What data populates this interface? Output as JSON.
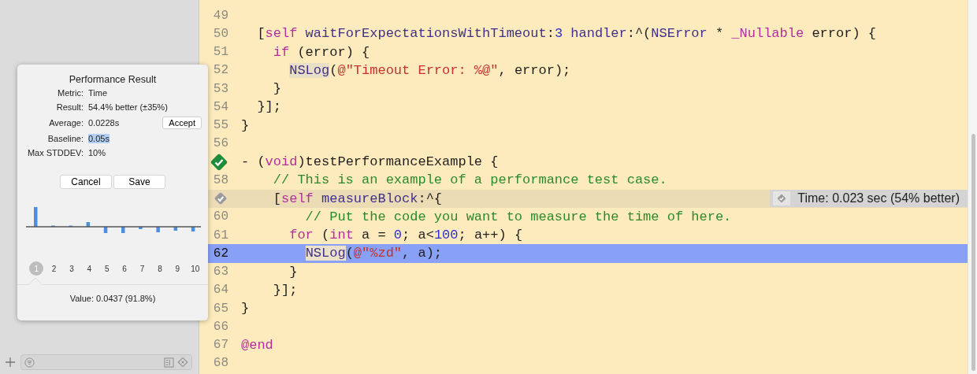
{
  "popover": {
    "title": "Performance Result",
    "fields": [
      {
        "label": "Metric:",
        "value": "Time",
        "selected": false
      },
      {
        "label": "Result:",
        "value": "54.4% better (±35%)",
        "selected": false
      },
      {
        "label": "Average:",
        "value": "0.0228s",
        "selected": false,
        "action": "Accept"
      },
      {
        "label": "Baseline:",
        "value": "0.05s",
        "selected": true
      },
      {
        "label": "Max STDDEV:",
        "value": "10%",
        "selected": false
      }
    ],
    "buttons": [
      "Cancel",
      "Save"
    ],
    "iterations": [
      {
        "label": "1",
        "selected": true
      },
      {
        "label": "2",
        "selected": false
      },
      {
        "label": "3",
        "selected": false
      },
      {
        "label": "4",
        "selected": false
      },
      {
        "label": "5",
        "selected": false
      },
      {
        "label": "6",
        "selected": false
      },
      {
        "label": "7",
        "selected": false
      },
      {
        "label": "8",
        "selected": false
      },
      {
        "label": "9",
        "selected": false
      },
      {
        "label": "10",
        "selected": false
      }
    ],
    "value_text": "Value:  0.0437 (91.8%)"
  },
  "editor": {
    "lines": [
      {
        "kind": "code",
        "number": "49",
        "selected": false,
        "highlighted": false
      },
      {
        "kind": "code",
        "number": "50",
        "selected": false,
        "highlighted": false,
        "tokens": [
          {
            "text": "  [",
            "kind": "plain"
          },
          {
            "text": "self",
            "kind": "keyword"
          },
          {
            "text": " waitForExpectationsWithTimeout",
            "kind": "method"
          },
          {
            "text": ":",
            "kind": "plain"
          },
          {
            "text": "3",
            "kind": "number"
          },
          {
            "text": " handler",
            "kind": "method"
          },
          {
            "text": ":^(",
            "kind": "plain"
          },
          {
            "text": "NSError",
            "kind": "method"
          },
          {
            "text": " * ",
            "kind": "plain"
          },
          {
            "text": "_Nullable",
            "kind": "keyword"
          },
          {
            "text": " error) {",
            "kind": "plain"
          }
        ]
      },
      {
        "kind": "code",
        "number": "51",
        "selected": false,
        "highlighted": false,
        "tokens": [
          {
            "text": "    if",
            "kind": "keyword"
          },
          {
            "text": " (error) {",
            "kind": "plain"
          }
        ]
      },
      {
        "kind": "code",
        "number": "52",
        "selected": false,
        "highlighted": false,
        "tokens": [
          {
            "text": "      NSLog",
            "kind": "symbol"
          },
          {
            "text": "(",
            "kind": "plain"
          },
          {
            "text": "@\"Timeout Error: %@\"",
            "kind": "string"
          },
          {
            "text": ", error);",
            "kind": "plain"
          }
        ]
      },
      {
        "kind": "code",
        "number": "53",
        "selected": false,
        "highlighted": false,
        "tokens": [
          {
            "text": "    }",
            "kind": "plain"
          }
        ]
      },
      {
        "kind": "code",
        "number": "54",
        "selected": false,
        "highlighted": false,
        "tokens": [
          {
            "text": "  }];",
            "kind": "plain"
          }
        ]
      },
      {
        "kind": "code",
        "number": "55",
        "selected": false,
        "highlighted": false,
        "tokens": [
          {
            "text": "}",
            "kind": "plain"
          }
        ]
      },
      {
        "kind": "code",
        "number": "56",
        "selected": false,
        "highlighted": false
      },
      {
        "kind": "passed",
        "selected": false,
        "highlighted": false,
        "tokens": [
          {
            "text": "- (",
            "kind": "plain"
          },
          {
            "text": "void",
            "kind": "keyword"
          },
          {
            "text": ")testPerformanceExample {",
            "kind": "plain"
          }
        ]
      },
      {
        "kind": "code",
        "number": "58",
        "selected": false,
        "highlighted": false,
        "tokens": [
          {
            "text": "    // This is an example of a performance test case.",
            "kind": "comment"
          }
        ]
      },
      {
        "kind": "measured",
        "selected": false,
        "highlighted": true,
        "annotation": "Time: 0.023 sec (54% better)",
        "tokens": [
          {
            "text": "    [",
            "kind": "plain"
          },
          {
            "text": "self",
            "kind": "keyword"
          },
          {
            "text": " measureBlock",
            "kind": "method"
          },
          {
            "text": ":^{",
            "kind": "plain"
          }
        ]
      },
      {
        "kind": "code",
        "number": "60",
        "selected": false,
        "highlighted": false,
        "tokens": [
          {
            "text": "        // Put the code you want to measure the time of here.",
            "kind": "comment"
          }
        ]
      },
      {
        "kind": "code",
        "number": "61",
        "selected": false,
        "highlighted": false,
        "tokens": [
          {
            "text": "      for",
            "kind": "keyword"
          },
          {
            "text": " (",
            "kind": "plain"
          },
          {
            "text": "int",
            "kind": "keyword"
          },
          {
            "text": " a = ",
            "kind": "plain"
          },
          {
            "text": "0",
            "kind": "number"
          },
          {
            "text": "; a<",
            "kind": "plain"
          },
          {
            "text": "100",
            "kind": "number"
          },
          {
            "text": "; a++) {",
            "kind": "plain"
          }
        ]
      },
      {
        "kind": "code",
        "number": "62",
        "selected": true,
        "highlighted": false,
        "tokens": [
          {
            "text": "        NSLog",
            "kind": "symbol"
          },
          {
            "text": "(",
            "kind": "plain"
          },
          {
            "text": "@\"%zd\"",
            "kind": "string"
          },
          {
            "text": ", a);",
            "kind": "plain"
          }
        ]
      },
      {
        "kind": "code",
        "number": "63",
        "selected": false,
        "highlighted": false,
        "tokens": [
          {
            "text": "      }",
            "kind": "plain"
          }
        ]
      },
      {
        "kind": "code",
        "number": "64",
        "selected": false,
        "highlighted": false,
        "tokens": [
          {
            "text": "    }];",
            "kind": "plain"
          }
        ]
      },
      {
        "kind": "code",
        "number": "65",
        "selected": false,
        "highlighted": false,
        "tokens": [
          {
            "text": "}",
            "kind": "plain"
          }
        ]
      },
      {
        "kind": "code",
        "number": "66",
        "selected": false,
        "highlighted": false
      },
      {
        "kind": "code",
        "number": "67",
        "selected": false,
        "highlighted": false,
        "tokens": [
          {
            "text": "@end",
            "kind": "keyword"
          }
        ]
      },
      {
        "kind": "code",
        "number": "68",
        "selected": false,
        "highlighted": false
      }
    ]
  }
}
